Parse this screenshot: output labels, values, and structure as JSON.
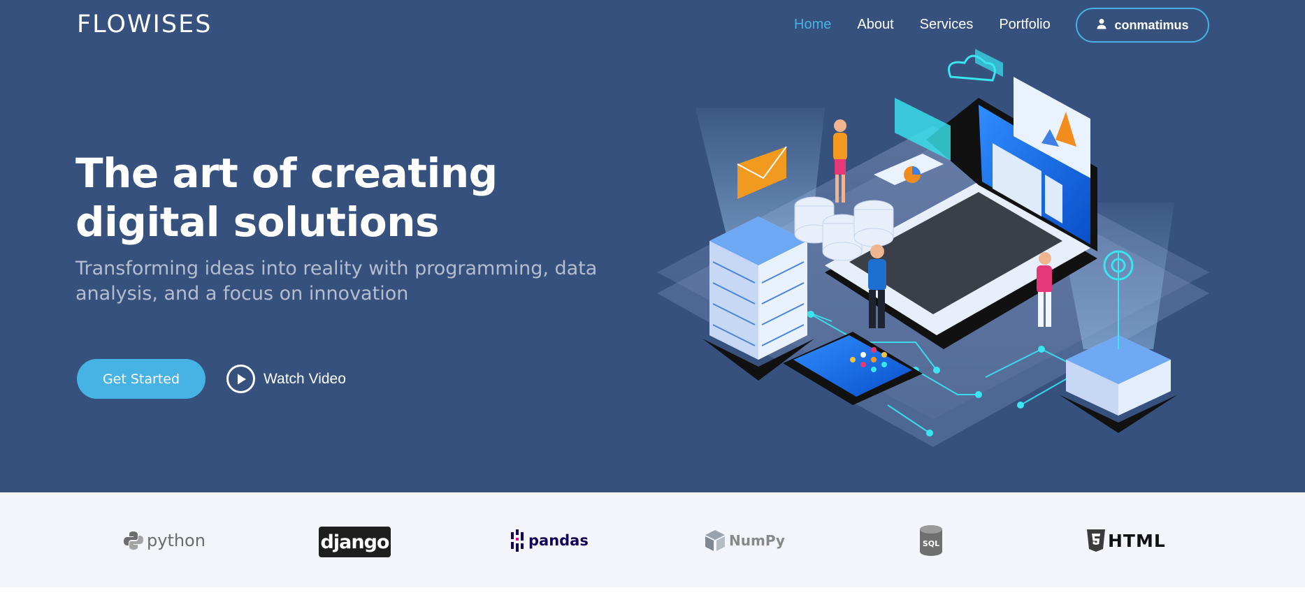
{
  "brand": {
    "logo_text": "FLOWISES"
  },
  "nav": {
    "items": [
      {
        "label": "Home",
        "active": true
      },
      {
        "label": "About",
        "active": false
      },
      {
        "label": "Services",
        "active": false
      },
      {
        "label": "Portfolio",
        "active": false
      }
    ],
    "user_label": "conmatimus",
    "user_icon": "user-icon"
  },
  "hero": {
    "title": "The art of creating digital solutions",
    "subtitle": "Transforming ideas into reality with programming, data analysis, and a focus on innovation",
    "cta_label": "Get Started",
    "video_label": "Watch Video",
    "video_icon": "play-circle-icon"
  },
  "clients": [
    {
      "name": "python",
      "text": "python",
      "icon": "python-logo"
    },
    {
      "name": "django",
      "text": "django",
      "icon": "django-logo"
    },
    {
      "name": "pandas",
      "text": "pandas",
      "icon": "pandas-logo"
    },
    {
      "name": "numpy",
      "text": "NumPy",
      "icon": "numpy-logo"
    },
    {
      "name": "sql",
      "text": "SQL",
      "icon": "sql-database-logo"
    },
    {
      "name": "html",
      "text": "HTML",
      "icon": "html5-logo"
    }
  ],
  "colors": {
    "hero_bg": "#37517e",
    "accent": "#47b2e4",
    "clients_bg": "#f3f5fa"
  }
}
